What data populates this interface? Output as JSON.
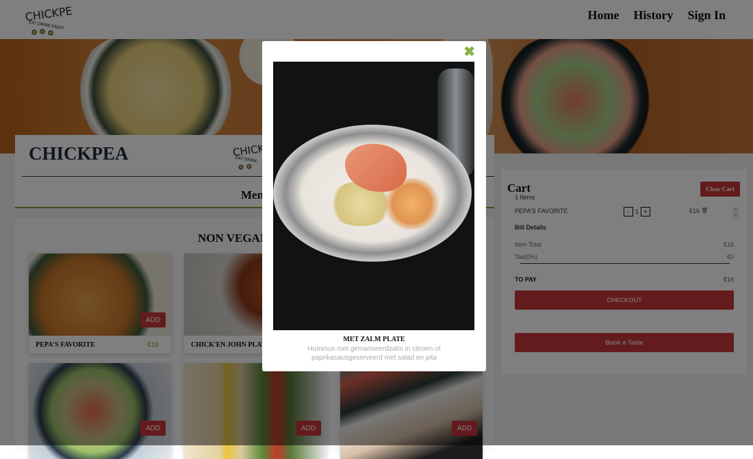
{
  "header": {
    "logo": {
      "name": "CHICKPEA",
      "tagline": "EAT DRINK ENJOY"
    },
    "nav": [
      {
        "label": "Home"
      },
      {
        "label": "History"
      },
      {
        "label": "Sign In"
      }
    ]
  },
  "restaurant": {
    "title": "CHICKPEA",
    "logo": {
      "name": "CHICK",
      "tagline": "EAT DRINK"
    },
    "tab_label": "Menu"
  },
  "menu": {
    "section_heading": "NON VEGAN",
    "items": [
      {
        "name": "PEPA'S FAVORITE",
        "price": "€16",
        "add_label": "ADD"
      },
      {
        "name": "CHICK'EN JOHN PLATE",
        "price": "",
        "add_label": "ADD"
      },
      {
        "name": "",
        "price": "",
        "add_label": "ADD"
      },
      {
        "name": "",
        "price": "",
        "add_label": "ADD"
      },
      {
        "name": "",
        "price": "",
        "add_label": "ADD"
      }
    ]
  },
  "cart": {
    "title": "Cart",
    "count": "1 Items",
    "clear_label": "Clear Cart",
    "items": [
      {
        "name": "PEPA'S FAVORITE",
        "qty": "1",
        "price": "€16",
        "minus": "-",
        "plus": "+"
      }
    ],
    "bill_title": "Bill Details",
    "item_total_label": "Item Total",
    "item_total_value": "€16",
    "tax_label": "Tax(0%)",
    "tax_value": "€0",
    "to_pay_label": "TO PAY",
    "to_pay_value": "€16",
    "checkout_label": "CHECKOUT",
    "book_label": "Book a Table"
  },
  "modal": {
    "close_icon": "✖",
    "title": "MET ZALM PLATE",
    "description": "Hummus met gemarineerdzalm in citroen of paprikasausgeserveerd met salad en pita"
  },
  "colors": {
    "accent_red": "#c9363b",
    "accent_green": "#7c9a36",
    "close_green": "#8bb04a"
  }
}
